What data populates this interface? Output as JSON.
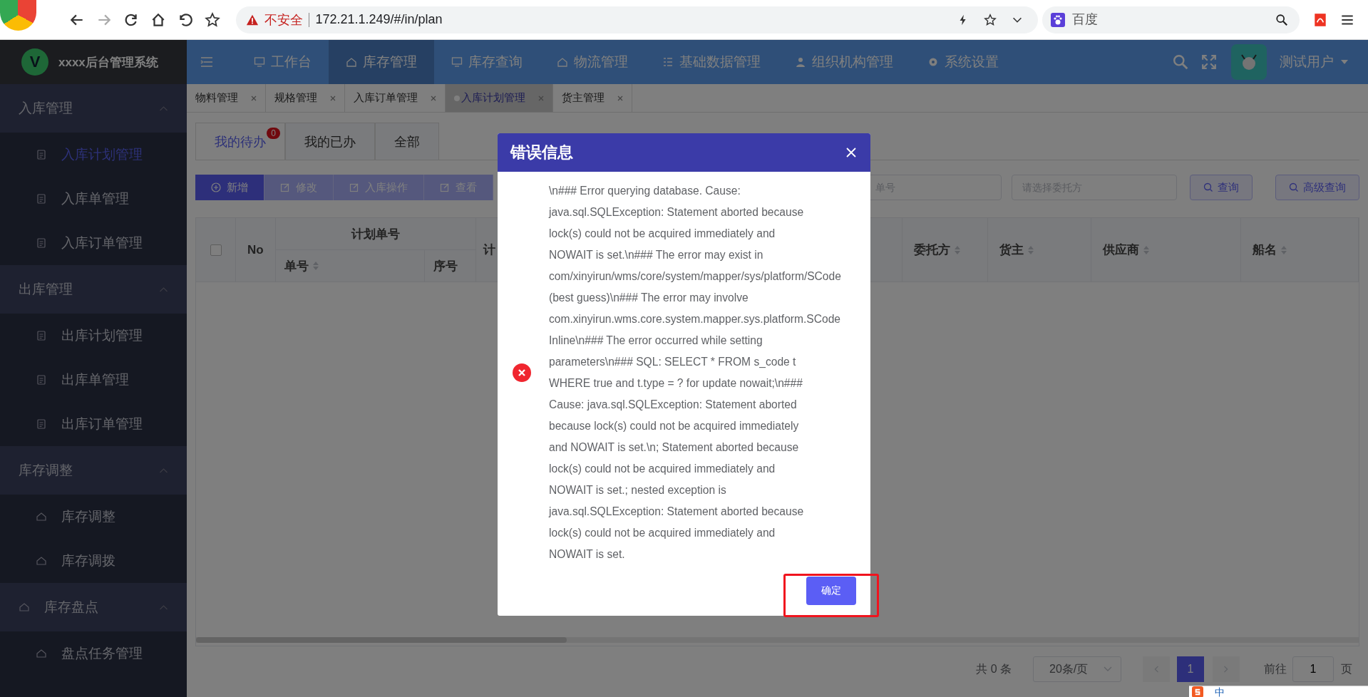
{
  "browser": {
    "warning": "不安全",
    "url": "172.21.1.249/#/in/plan",
    "search_placeholder": "百度"
  },
  "app": {
    "title": "xxxx后台管理系统",
    "logo_letter": "V"
  },
  "nav": [
    {
      "label": "工作台",
      "selected": false
    },
    {
      "label": "库存管理",
      "selected": true
    },
    {
      "label": "库存查询",
      "selected": false
    },
    {
      "label": "物流管理",
      "selected": false
    },
    {
      "label": "基础数据管理",
      "selected": false
    },
    {
      "label": "组织机构管理",
      "selected": false
    },
    {
      "label": "系统设置",
      "selected": false
    }
  ],
  "user": {
    "name": "测试用户"
  },
  "page_tabs": [
    {
      "label": "物料管理",
      "selected": false
    },
    {
      "label": "规格管理",
      "selected": false
    },
    {
      "label": "入库订单管理",
      "selected": false
    },
    {
      "label": "入库计划管理",
      "selected": true
    },
    {
      "label": "货主管理",
      "selected": false
    }
  ],
  "sidebar": {
    "groups": [
      {
        "label": "入库管理",
        "kind": "plain",
        "expanded": true,
        "items": [
          {
            "label": "入库计划管理",
            "selected": true
          },
          {
            "label": "入库单管理",
            "selected": false
          },
          {
            "label": "入库订单管理",
            "selected": false
          }
        ]
      },
      {
        "label": "出库管理",
        "kind": "plain",
        "expanded": true,
        "items": [
          {
            "label": "出库计划管理",
            "selected": false
          },
          {
            "label": "出库单管理",
            "selected": false
          },
          {
            "label": "出库订单管理",
            "selected": false
          }
        ]
      },
      {
        "label": "库存调整",
        "kind": "plain",
        "expanded": true,
        "items": [
          {
            "label": "库存调整",
            "selected": false
          },
          {
            "label": "库存调拨",
            "selected": false
          }
        ]
      },
      {
        "label": "库存盘点",
        "kind": "icon",
        "expanded": true,
        "items": [
          {
            "label": "盘点任务管理",
            "selected": false
          }
        ]
      }
    ]
  },
  "sub_tabs": [
    {
      "label": "我的待办",
      "selected": true,
      "badge": "0"
    },
    {
      "label": "我的已办",
      "selected": false
    },
    {
      "label": "全部",
      "selected": false
    }
  ],
  "toolbar": [
    {
      "label": "新增",
      "kind": "primary"
    },
    {
      "label": "修改",
      "kind": "plain"
    },
    {
      "label": "入库操作",
      "kind": "plain"
    },
    {
      "label": "查看",
      "kind": "plain"
    }
  ],
  "filters": [
    {
      "placeholder": "单号"
    },
    {
      "placeholder": "请选择委托方"
    }
  ],
  "search_buttons": [
    "查询",
    "高级查询"
  ],
  "table": {
    "select_all": {
      "checked": false
    },
    "columns": [
      {
        "label": "No",
        "sortable": false
      },
      {
        "label": "计划单号",
        "children": [
          {
            "label": "单号",
            "sortable": true
          },
          {
            "label": "序号",
            "sortable": false
          }
        ]
      },
      {
        "label": "计",
        "sortable": false
      },
      {
        "label": "委托方",
        "sortable": true
      },
      {
        "label": "货主",
        "sortable": true
      },
      {
        "label": "供应商",
        "sortable": true
      },
      {
        "label": "船名",
        "sortable": true
      }
    ]
  },
  "pagination": {
    "total": "共 0 条",
    "page_size": "20条/页",
    "pages": [
      {
        "label": "1",
        "selected": true
      }
    ],
    "goto_label": "前往",
    "goto_value": "1",
    "goto_suffix": "页"
  },
  "dialog": {
    "title": "错误信息",
    "ok": "确定",
    "message_lines": [
      "\\n### Error querying database. Cause:",
      "java.sql.SQLException: Statement aborted because",
      "lock(s) could not be acquired immediately and",
      "NOWAIT is set.\\n### The error may exist in",
      "com/xinyirun/wms/core/system/mapper/sys/platform/SCode",
      "(best guess)\\n### The error may involve",
      "com.xinyirun.wms.core.system.mapper.sys.platform.SCode",
      "Inline\\n### The error occurred while setting",
      "parameters\\n### SQL: SELECT * FROM s_code t",
      "WHERE true and t.type = ? for update nowait;\\n###",
      "Cause: java.sql.SQLException: Statement aborted",
      "because lock(s) could not be acquired immediately",
      "and NOWAIT is set.\\n; Statement aborted because",
      "lock(s) could not be acquired immediately and",
      "NOWAIT is set.; nested exception is",
      "java.sql.SQLException: Statement aborted because",
      "lock(s) could not be acquired immediately and",
      "NOWAIT is set."
    ]
  },
  "ime": {
    "label": "中"
  }
}
